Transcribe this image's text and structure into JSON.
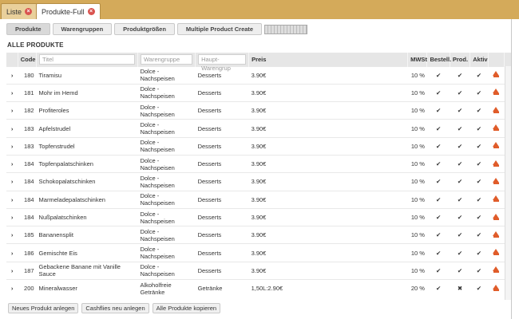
{
  "window_tabs": [
    {
      "label": "Liste",
      "active": false
    },
    {
      "label": "Produkte-Full",
      "active": true
    }
  ],
  "subtabs": [
    {
      "label": "Produkte",
      "active": true
    },
    {
      "label": "Warengruppen",
      "active": false
    },
    {
      "label": "Produktgrößen",
      "active": false
    },
    {
      "label": "Multiple Product Create",
      "active": false
    }
  ],
  "section_title": "ALLE PRODUKTE",
  "table": {
    "headers": {
      "code": "Code",
      "titel": "Titel",
      "warengruppe": "Warengruppe",
      "haupt": "Haupt-Warengrup",
      "preis": "Preis",
      "mwst": "MWSt",
      "bestell": "Bestell.",
      "prod": "Prod.",
      "aktiv": "Aktiv"
    },
    "rows": [
      {
        "code": "180",
        "titel": "Tiramisu",
        "warengruppe": "Dolce - Nachspeisen",
        "haupt": "Desserts",
        "preis": "3.90€",
        "mwst": "10 %",
        "bestell": "✔",
        "prod": "✔",
        "aktiv": "✔"
      },
      {
        "code": "181",
        "titel": "Mohr im Hemd",
        "warengruppe": "Dolce - Nachspeisen",
        "haupt": "Desserts",
        "preis": "3.90€",
        "mwst": "10 %",
        "bestell": "✔",
        "prod": "✔",
        "aktiv": "✔"
      },
      {
        "code": "182",
        "titel": "Profiteroles",
        "warengruppe": "Dolce - Nachspeisen",
        "haupt": "Desserts",
        "preis": "3.90€",
        "mwst": "10 %",
        "bestell": "✔",
        "prod": "✔",
        "aktiv": "✔"
      },
      {
        "code": "183",
        "titel": "Apfelstrudel",
        "warengruppe": "Dolce - Nachspeisen",
        "haupt": "Desserts",
        "preis": "3.90€",
        "mwst": "10 %",
        "bestell": "✔",
        "prod": "✔",
        "aktiv": "✔"
      },
      {
        "code": "183",
        "titel": "Topfenstrudel",
        "warengruppe": "Dolce - Nachspeisen",
        "haupt": "Desserts",
        "preis": "3.90€",
        "mwst": "10 %",
        "bestell": "✔",
        "prod": "✔",
        "aktiv": "✔"
      },
      {
        "code": "184",
        "titel": "Topfenpalatschinken",
        "warengruppe": "Dolce - Nachspeisen",
        "haupt": "Desserts",
        "preis": "3.90€",
        "mwst": "10 %",
        "bestell": "✔",
        "prod": "✔",
        "aktiv": "✔"
      },
      {
        "code": "184",
        "titel": "Schokopalatschinken",
        "warengruppe": "Dolce - Nachspeisen",
        "haupt": "Desserts",
        "preis": "3.90€",
        "mwst": "10 %",
        "bestell": "✔",
        "prod": "✔",
        "aktiv": "✔"
      },
      {
        "code": "184",
        "titel": "Marmeladepalatschinken",
        "warengruppe": "Dolce - Nachspeisen",
        "haupt": "Desserts",
        "preis": "3.90€",
        "mwst": "10 %",
        "bestell": "✔",
        "prod": "✔",
        "aktiv": "✔"
      },
      {
        "code": "184",
        "titel": "Nußpalatschinken",
        "warengruppe": "Dolce - Nachspeisen",
        "haupt": "Desserts",
        "preis": "3.90€",
        "mwst": "10 %",
        "bestell": "✔",
        "prod": "✔",
        "aktiv": "✔"
      },
      {
        "code": "185",
        "titel": "Bananensplit",
        "warengruppe": "Dolce - Nachspeisen",
        "haupt": "Desserts",
        "preis": "3.90€",
        "mwst": "10 %",
        "bestell": "✔",
        "prod": "✔",
        "aktiv": "✔"
      },
      {
        "code": "186",
        "titel": "Gemischte Eis",
        "warengruppe": "Dolce - Nachspeisen",
        "haupt": "Desserts",
        "preis": "3.90€",
        "mwst": "10 %",
        "bestell": "✔",
        "prod": "✔",
        "aktiv": "✔"
      },
      {
        "code": "187",
        "titel": "Gebackene Banane mit Vanille Sauce",
        "warengruppe": "Dolce - Nachspeisen",
        "haupt": "Desserts",
        "preis": "3.90€",
        "mwst": "10 %",
        "bestell": "✔",
        "prod": "✔",
        "aktiv": "✔"
      },
      {
        "code": "200",
        "titel": "Mineralwasser",
        "warengruppe": "Alkoholfreie Getränke",
        "haupt": "Getränke",
        "preis": "1,50L:2.90€",
        "mwst": "20 %",
        "bestell": "✔",
        "prod": "✖",
        "aktiv": "✔"
      }
    ]
  },
  "icons": {
    "expand": "chevron-right-icon",
    "edit": "edit-icon",
    "close": "close-icon",
    "check": "check-icon",
    "cross": "cross-icon"
  },
  "colors": {
    "topbar": "#d4aa5a",
    "close": "#d9534f",
    "edit": "#e05c2a"
  },
  "footer_buttons": [
    {
      "label": "Neues Produkt anlegen"
    },
    {
      "label": "Cashflies neu anlegen"
    },
    {
      "label": "Alle Produkte kopieren"
    }
  ]
}
